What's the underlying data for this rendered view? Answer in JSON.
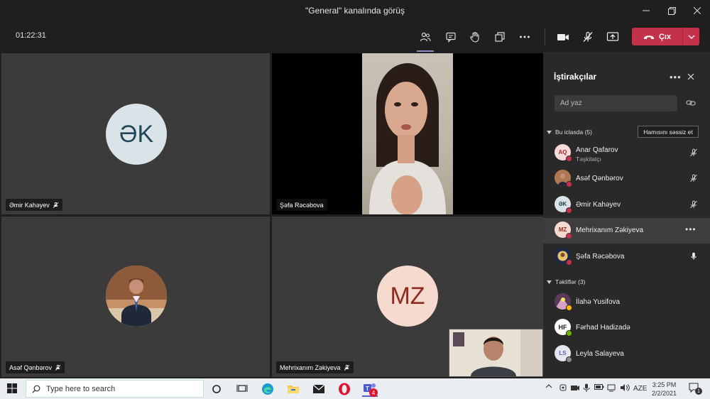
{
  "window": {
    "title": "\"General\" kanalında görüş"
  },
  "toolbar": {
    "timer": "01:22:31",
    "leave_label": "Çıx"
  },
  "tiles": [
    {
      "name": "Əmir Kahəyev",
      "initials": "ƏK",
      "mic": "muted",
      "avatar_bg": "#d9e3e8",
      "initials_color": "#1f4756"
    },
    {
      "name": "Şəfa Rəcəbova",
      "video": true
    },
    {
      "name": "Asəf Qənbərov",
      "mic": "muted",
      "photo": true
    },
    {
      "name": "Mehrixanım Zəkiyeva",
      "initials": "MZ",
      "mic": "muted",
      "avatar_bg": "#f6d9cf",
      "initials_color": "#8c2b1f"
    }
  ],
  "self_view": {
    "video": true
  },
  "panel": {
    "title": "İştirakçılar",
    "search_placeholder": "Ad yaz",
    "in_meeting_label": "Bu iclasda (5)",
    "mute_all_label": "Hamısını səssiz et",
    "in_meeting": [
      {
        "name": "Anar Qafarov",
        "role": "Təşkilatçı",
        "initials": "AQ",
        "avatar_bg": "#f8dada",
        "initials_color": "#a4262c",
        "status_color": "#c4314b",
        "mic": "muted"
      },
      {
        "name": "Asəf Qənbərov",
        "initials": "",
        "photo": true,
        "status_color": "#c4314b",
        "mic": "muted"
      },
      {
        "name": "Əmir Kahəyev",
        "initials": "ƏK",
        "avatar_bg": "#d9e3e8",
        "initials_color": "#1f4756",
        "status_color": "#c4314b",
        "mic": "muted"
      },
      {
        "name": "Mehrixanım Zəkiyeva",
        "initials": "MZ",
        "avatar_bg": "#f6d9cf",
        "initials_color": "#8c2b1f",
        "status_color": "#c4314b",
        "mic": "more"
      },
      {
        "name": "Şəfa Rəcəbova",
        "initials": "",
        "photo": true,
        "status_color": "#c4314b",
        "mic": "on"
      }
    ],
    "suggestions_label": "Təkliflər (3)",
    "suggestions": [
      {
        "name": "İlahə Yusifova",
        "initials": "",
        "photo": true,
        "status_color": "#fcb900"
      },
      {
        "name": "Fərhad Hadizadə",
        "initials": "HF",
        "avatar_bg": "#ffffff",
        "initials_color": "#222222",
        "status_color": "#6bb700"
      },
      {
        "name": "Leyla Salayeva",
        "initials": "LS",
        "avatar_bg": "#e6e6f0",
        "initials_color": "#5b5fc7",
        "status_color": "#8a8a8a"
      }
    ]
  },
  "taskbar": {
    "search_placeholder": "Type here to search",
    "language": "AZE",
    "time": "3:25 PM",
    "date": "2/2/2021",
    "teams_badge": "4",
    "notification_badge": "1"
  }
}
